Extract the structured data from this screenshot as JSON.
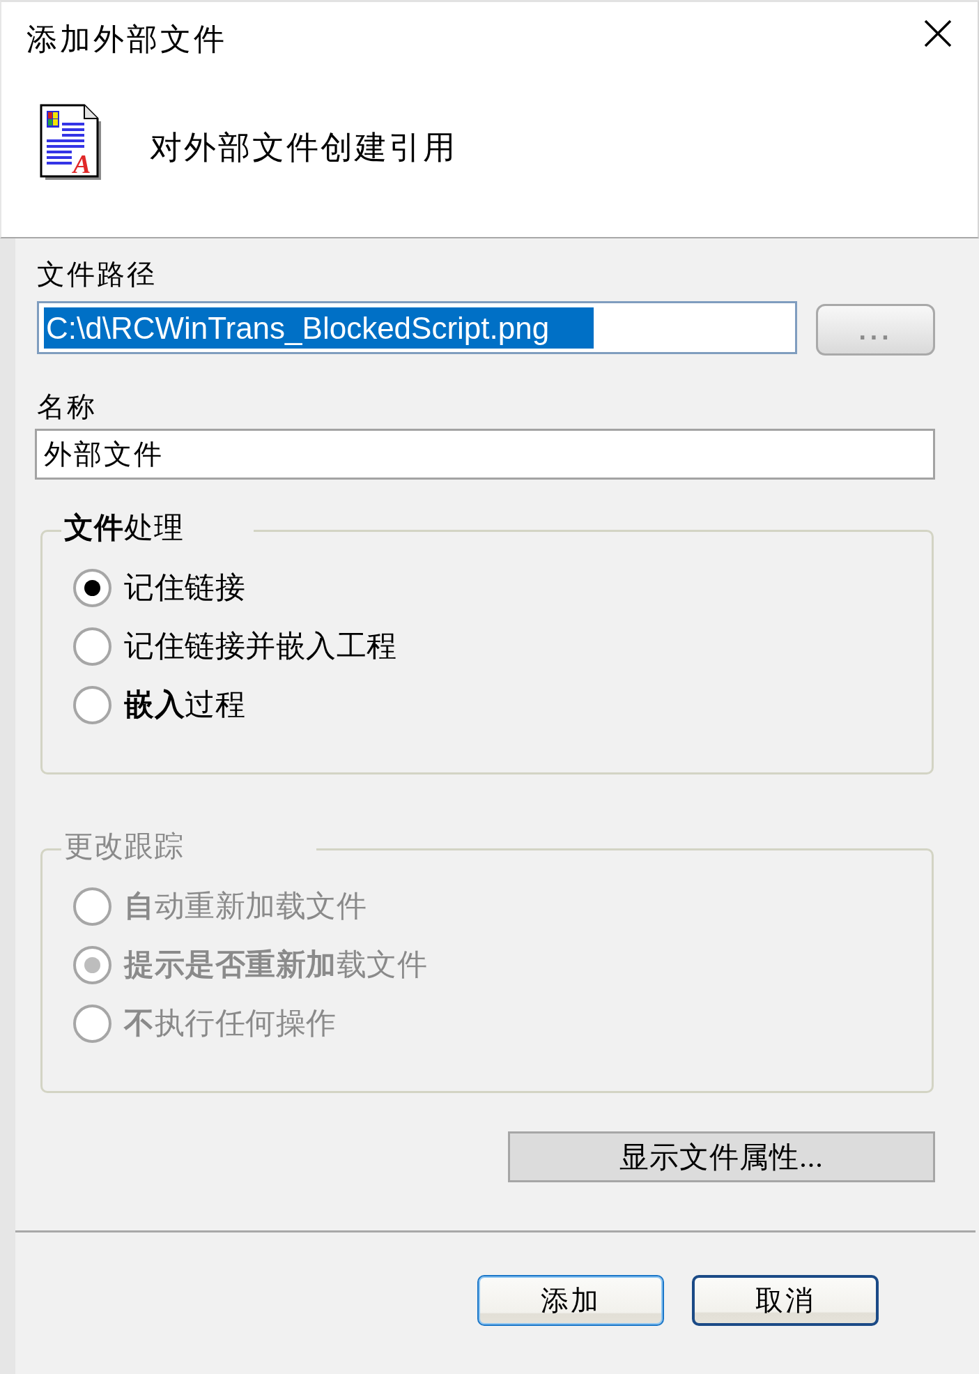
{
  "window": {
    "title": "添加外部文件"
  },
  "header": {
    "subtitle": "对外部文件创建引用",
    "icon_letter": "A"
  },
  "file_path": {
    "label": "文件路径",
    "value": "C:\\d\\RCWinTrans_BlockedScript.png",
    "selected": true
  },
  "browse_button": {
    "label": "..."
  },
  "name": {
    "label": "名称",
    "value": "外部文件"
  },
  "groups": [
    {
      "title": "**文件**处理",
      "disabled": false,
      "options": [
        {
          "label": "记住链接",
          "selected": true
        },
        {
          "label": "记住链接并嵌入工程",
          "selected": false
        },
        {
          "label": "**嵌入**过程",
          "selected": false
        }
      ]
    },
    {
      "title": "更改跟踪",
      "disabled": true,
      "options": [
        {
          "label": "**自**动重新加载文件",
          "selected": false
        },
        {
          "label": "**提示是否重新加**载文件",
          "selected": true
        },
        {
          "label": "**不**执行任何操作",
          "selected": false
        }
      ]
    }
  ],
  "properties_button": {
    "label": "显示文件属性..."
  },
  "buttons": [
    {
      "label": "添加",
      "focused": true
    },
    {
      "label": "取消",
      "focused": false
    }
  ]
}
